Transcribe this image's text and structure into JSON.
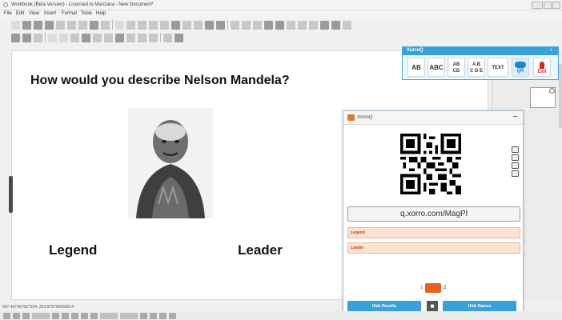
{
  "window": {
    "title": "Workbook (Beta Version) - Licensed to Manzana - New Document*"
  },
  "menu": [
    "File",
    "Edit",
    "View",
    "Insert",
    "Format",
    "Tools",
    "Help"
  ],
  "slide": {
    "question": "How would you describe Nelson Mandela?",
    "answers": [
      "Legend",
      "Leader"
    ]
  },
  "ribbon": {
    "title": "XorroQ",
    "buttons": [
      {
        "label": "AB"
      },
      {
        "label": "ABC"
      },
      {
        "label": "AB\nCD"
      },
      {
        "label": "A B\nC D E"
      },
      {
        "label": "TEXT"
      },
      {
        "label": "QR"
      },
      {
        "label": "Exit"
      }
    ]
  },
  "xorroq": {
    "title": "XorroQ",
    "url": "q.xorro.com/MagPl",
    "responses": [
      "Legend",
      "Leader"
    ],
    "counter_left": "1",
    "counter_right": "2",
    "hide_results": "Hide Results",
    "hide_names": "Hide Names"
  },
  "status": {
    "coords": "667.467467567334, 263.878794268014"
  }
}
